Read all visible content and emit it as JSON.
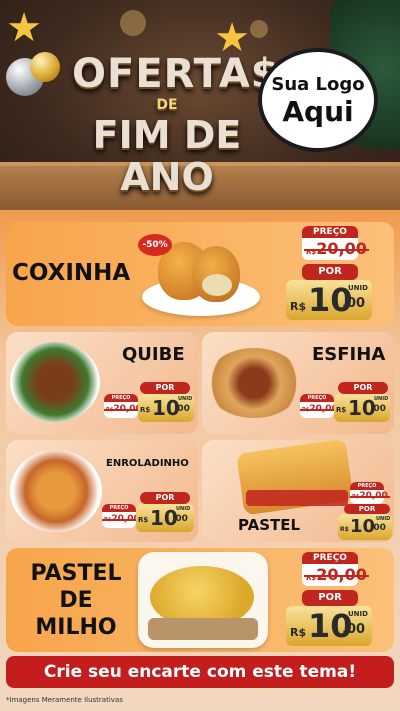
{
  "header": {
    "title_line1": "OFERTA$",
    "title_line2": "DE",
    "title_line3": "FIM DE ANO",
    "logo_line1": "Sua Logo",
    "logo_line2": "Aqui"
  },
  "labels": {
    "preco": "PREÇO",
    "por": "POR",
    "currency": "R$",
    "unid": "UNID"
  },
  "products": [
    {
      "name": "COXINHA",
      "old_price": "20,00",
      "new_price_int": "10",
      "new_price_dec": ",00",
      "discount": "-50%"
    },
    {
      "name": "QUIBE",
      "old_price": "20,00",
      "new_price_int": "10",
      "new_price_dec": ",00"
    },
    {
      "name": "ESFIHA",
      "old_price": "20,00",
      "new_price_int": "10",
      "new_price_dec": ",00"
    },
    {
      "name": "ENROLADINHO",
      "old_price": "20,00",
      "new_price_int": "10",
      "new_price_dec": ",00"
    },
    {
      "name": "PASTEL",
      "old_price": "20,00",
      "new_price_int": "10",
      "new_price_dec": ",00"
    },
    {
      "name_line1": "PASTEL",
      "name_line2": "DE",
      "name_line3": "MILHO",
      "old_price": "20,00",
      "new_price_int": "10",
      "new_price_dec": ",00"
    }
  ],
  "cta": "Crie seu encarte com este tema!",
  "footnote": "*Imagens Meramente Ilustrativas",
  "colors": {
    "accent_red": "#c0261d",
    "orange": "#f7a54a",
    "gold": "#d9a62e"
  }
}
